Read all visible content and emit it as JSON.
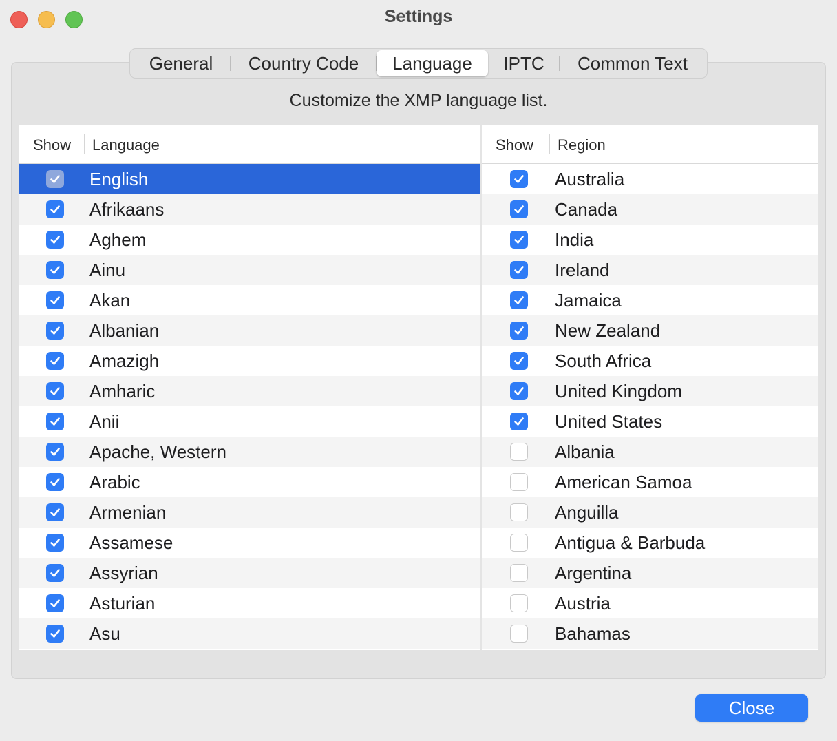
{
  "window": {
    "title": "Settings"
  },
  "tabs": [
    {
      "label": "General",
      "active": false
    },
    {
      "label": "Country Code",
      "active": false
    },
    {
      "label": "Language",
      "active": true
    },
    {
      "label": "IPTC",
      "active": false
    },
    {
      "label": "Common Text",
      "active": false
    }
  ],
  "subtitle": "Customize the XMP language list.",
  "language_table": {
    "headers": {
      "show": "Show",
      "language": "Language"
    },
    "rows": [
      {
        "name": "English",
        "checked": true,
        "selected": true
      },
      {
        "name": "Afrikaans",
        "checked": true
      },
      {
        "name": "Aghem",
        "checked": true
      },
      {
        "name": "Ainu",
        "checked": true
      },
      {
        "name": "Akan",
        "checked": true
      },
      {
        "name": "Albanian",
        "checked": true
      },
      {
        "name": "Amazigh",
        "checked": true
      },
      {
        "name": "Amharic",
        "checked": true
      },
      {
        "name": "Anii",
        "checked": true
      },
      {
        "name": "Apache, Western",
        "checked": true
      },
      {
        "name": "Arabic",
        "checked": true
      },
      {
        "name": "Armenian",
        "checked": true
      },
      {
        "name": "Assamese",
        "checked": true
      },
      {
        "name": "Assyrian",
        "checked": true
      },
      {
        "name": "Asturian",
        "checked": true
      },
      {
        "name": "Asu",
        "checked": true
      }
    ]
  },
  "region_table": {
    "headers": {
      "show": "Show",
      "region": "Region"
    },
    "rows": [
      {
        "name": "Australia",
        "checked": true
      },
      {
        "name": "Canada",
        "checked": true
      },
      {
        "name": "India",
        "checked": true
      },
      {
        "name": "Ireland",
        "checked": true
      },
      {
        "name": "Jamaica",
        "checked": true
      },
      {
        "name": "New Zealand",
        "checked": true
      },
      {
        "name": "South Africa",
        "checked": true
      },
      {
        "name": "United Kingdom",
        "checked": true
      },
      {
        "name": "United States",
        "checked": true
      },
      {
        "name": "Albania",
        "checked": false
      },
      {
        "name": "American Samoa",
        "checked": false
      },
      {
        "name": "Anguilla",
        "checked": false
      },
      {
        "name": "Antigua & Barbuda",
        "checked": false
      },
      {
        "name": "Argentina",
        "checked": false
      },
      {
        "name": "Austria",
        "checked": false
      },
      {
        "name": "Bahamas",
        "checked": false
      }
    ]
  },
  "footer": {
    "close_label": "Close"
  },
  "colors": {
    "accent": "#2f7cf6",
    "selection": "#2a66d9"
  }
}
